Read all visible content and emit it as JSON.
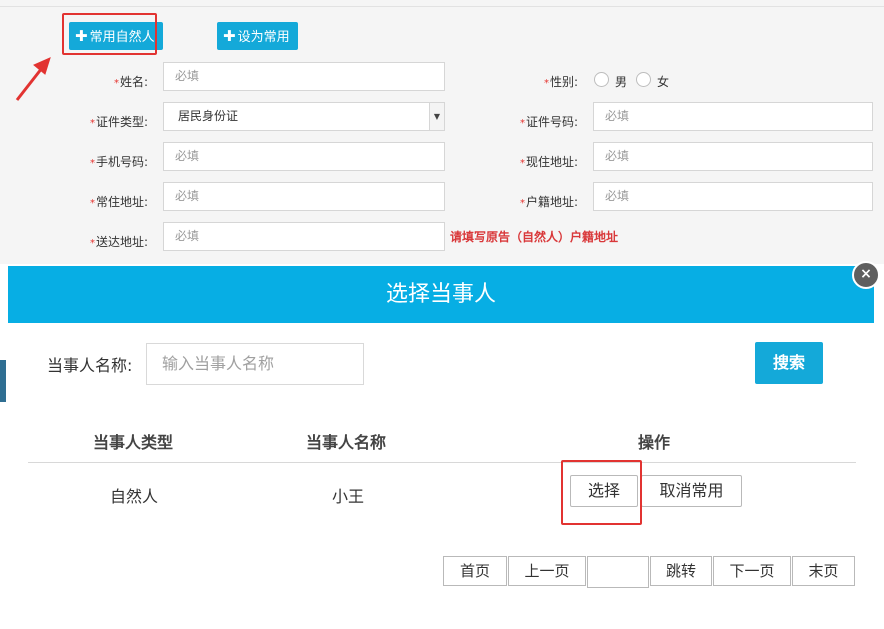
{
  "toolbar": {
    "common_person_button": "常用自然人",
    "set_common_button": "设为常用",
    "plus_symbol": "✚"
  },
  "form": {
    "name": {
      "label": "姓名:",
      "placeholder": "必填"
    },
    "gender": {
      "label": "性别:",
      "options": [
        "男",
        "女"
      ]
    },
    "id_type": {
      "label": "证件类型:",
      "value": "居民身份证"
    },
    "id_number": {
      "label": "证件号码:",
      "placeholder": "必填"
    },
    "phone": {
      "label": "手机号码:",
      "placeholder": "必填"
    },
    "current_address": {
      "label": "现住地址:",
      "placeholder": "必填"
    },
    "usual_address": {
      "label": "常住地址:",
      "placeholder": "必填"
    },
    "household_address": {
      "label": "户籍地址:",
      "placeholder": "必填"
    },
    "delivery_address": {
      "label": "送达地址:",
      "placeholder": "必填"
    },
    "required_mark": "*",
    "hint": "请填写原告（自然人）户籍地址"
  },
  "modal": {
    "title": "选择当事人",
    "close_symbol": "×",
    "search_label": "当事人名称:",
    "search_placeholder": "输入当事人名称",
    "search_button": "搜索",
    "columns": [
      "当事人类型",
      "当事人名称",
      "操作"
    ],
    "rows": [
      {
        "type": "自然人",
        "name": "小王",
        "select_button": "选择",
        "cancel_button": "取消常用"
      }
    ],
    "pagination": {
      "first": "首页",
      "prev": "上一页",
      "page_input": "",
      "jump": "跳转",
      "next": "下一页",
      "last": "末页"
    }
  },
  "colors": {
    "accent": "#14a9d9",
    "header": "#07aee4",
    "annotation_red": "#e23331"
  }
}
